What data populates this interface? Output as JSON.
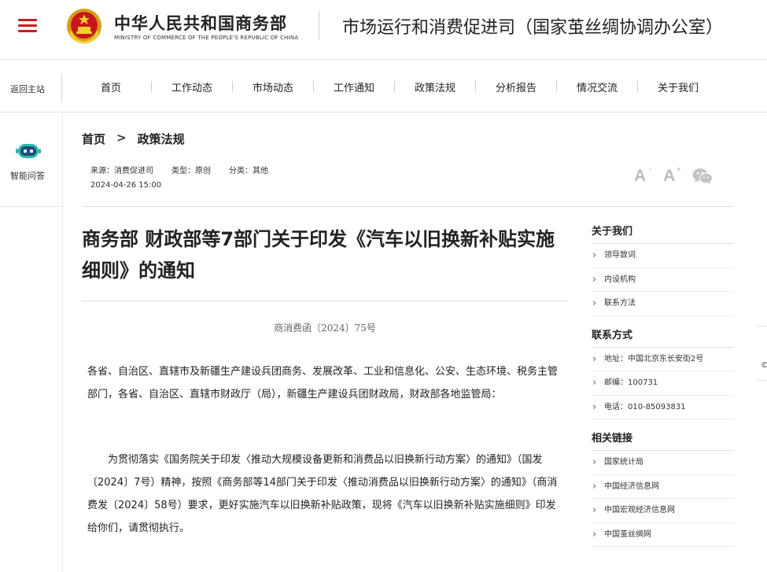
{
  "header": {
    "ministry_cn": "中华人民共和国商务部",
    "ministry_en": "MINISTRY OF COMMERCE OF THE PEOPLE'S REPUBLIC OF CHINA",
    "department": "市场运行和消费促进司（国家茧丝绸协调办公室）",
    "menu_icon": "hamburger-menu-icon",
    "emblem_icon": "national-emblem-icon"
  },
  "nav": {
    "back_home": "返回主站",
    "items": [
      "首页",
      "工作动态",
      "市场动态",
      "工作通知",
      "政策法规",
      "分析报告",
      "情况交流",
      "关于我们"
    ]
  },
  "left_widget": {
    "label": "智能问答",
    "icon": "robot-chat-icon"
  },
  "right_edge": {
    "glyph": "©"
  },
  "breadcrumb": {
    "home": "首页",
    "separator": ">",
    "current": "政策法规"
  },
  "meta": {
    "source": "来源：消费促进司",
    "type": "类型：原创",
    "category": "分类：其他",
    "date": "2024-04-26 15:00"
  },
  "tools": {
    "font_small": "A",
    "font_small_sup": "-",
    "font_large": "A",
    "font_large_sup": "+",
    "share_icon": "wechat-icon"
  },
  "article": {
    "title": "商务部 财政部等7部门关于印发《汽车以旧换新补贴实施细则》的通知",
    "doc_number": "商消费函〔2024〕75号",
    "para1": "各省、自治区、直辖市及新疆生产建设兵团商务、发展改革、工业和信息化、公安、生态环境、税务主管部门，各省、自治区、直辖市财政厅（局），新疆生产建设兵团财政局，财政部各地监管局：",
    "para2": "为贯彻落实《国务院关于印发〈推动大规模设备更新和消费品以旧换新行动方案〉的通知》（国发〔2024〕7号）精神，按照《商务部等14部门关于印发〈推动消费品以旧换新行动方案〉的通知》（商消费发〔2024〕58号）要求，更好实施汽车以旧换新补贴政策，现将《汽车以旧换新补贴实施细则》印发给你们，请贯彻执行。"
  },
  "sidebar": {
    "about": {
      "heading": "关于我们",
      "items": [
        "领导致词",
        "内设机构",
        "联系方法"
      ]
    },
    "contact": {
      "heading": "联系方式",
      "items": [
        "地址：中国北京东长安街2号",
        "邮编：100731",
        "电话：010-85093831"
      ]
    },
    "links": {
      "heading": "相关链接",
      "items": [
        "国家统计局",
        "中国经济信息网",
        "中国宏观经济信息网",
        "中国茧丝绸网"
      ]
    }
  }
}
